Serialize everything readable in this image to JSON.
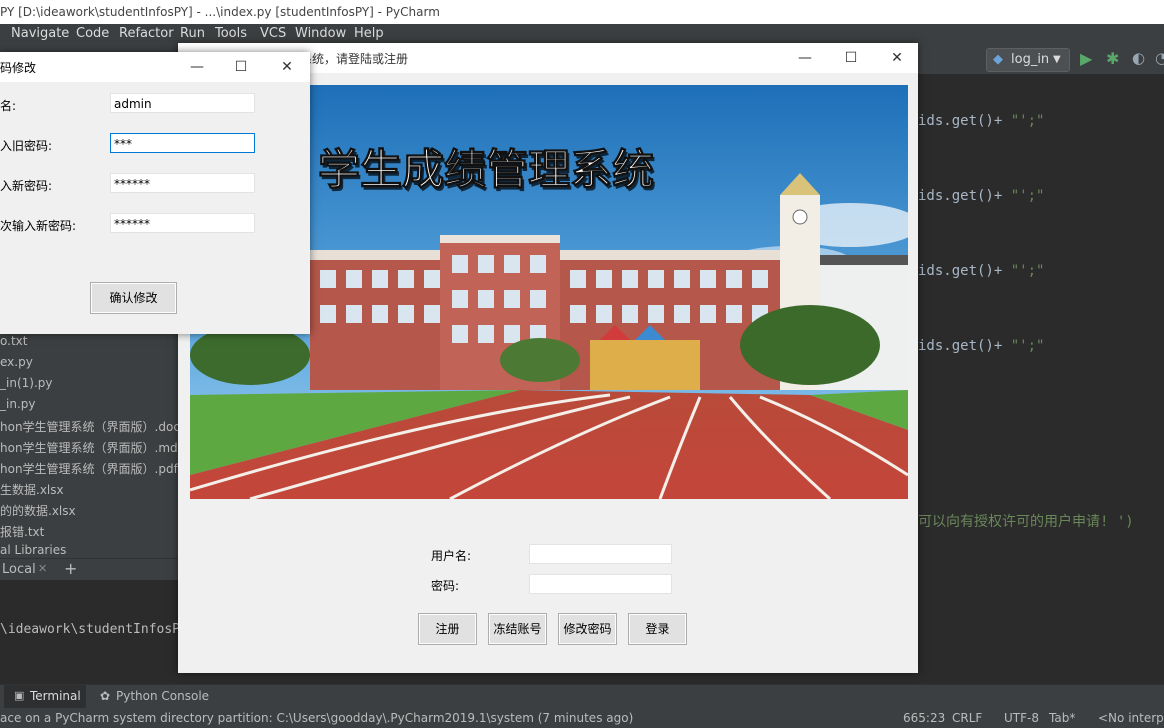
{
  "ide": {
    "title": "PY [D:\\ideawork\\studentInfosPY] - ...\\index.py [studentInfosPY] - PyCharm",
    "menu": [
      "Navigate",
      "Code",
      "Refactor",
      "Run",
      "Tools",
      "VCS",
      "Window",
      "Help"
    ],
    "run_config": "log_in",
    "code_lines": [
      {
        "text": "ids.get()+",
        "str": " \"';\""
      },
      {
        "text": "ids.get()+",
        "str": " \"';\""
      },
      {
        "text": "ids.get()+",
        "str": " \"';\""
      },
      {
        "text": "ids.get()+",
        "str": " \"';\""
      },
      {
        "text": "",
        "str": "可以向有授权许可的用户申请! ')"
      }
    ],
    "project_files": [
      "o.txt",
      "ex.py",
      "_in(1).py",
      "_in.py",
      "hon学生管理系统（界面版）.docx",
      "hon学生管理系统（界面版）.md",
      "hon学生管理系统（界面版）.pdf",
      "生数据.xlsx",
      "的的数据.xlsx",
      "报错.txt",
      "al Libraries"
    ],
    "terminal_tab": "Local",
    "terminal_text": "\\ideawork\\studentInfosP",
    "tool_tabs": [
      "Terminal",
      "Python Console"
    ],
    "status": {
      "message": "ace on a PyCharm system directory partition: C:\\Users\\goodday\\.PyCharm2019.1\\system (7 minutes ago)",
      "position": "665:23",
      "line_sep": "CRLF",
      "encoding": "UTF-8",
      "indent": "Tab*",
      "interpreter": "<No interpr"
    }
  },
  "main_window": {
    "title": "理系统，请登陆或注册",
    "banner_text": "学生成绩管理系统",
    "username_label": "用户名:",
    "password_label": "密码:",
    "username_value": "",
    "password_value": "",
    "buttons": [
      "注册",
      "冻结账号",
      "修改密码",
      "登录"
    ]
  },
  "password_dialog": {
    "title": "码修改",
    "fields": [
      {
        "label": "名:",
        "value": "admin"
      },
      {
        "label": "入旧密码:",
        "value": "***"
      },
      {
        "label": "入新密码:",
        "value": "******"
      },
      {
        "label": "次输入新密码:",
        "value": "******"
      }
    ],
    "confirm_button": "确认修改"
  },
  "colors": {
    "ide_bg": "#2b2b2b",
    "ide_panel": "#3c3f41",
    "string_green": "#6a8759",
    "run_green": "#59a869",
    "focus_border": "#0078d7"
  }
}
